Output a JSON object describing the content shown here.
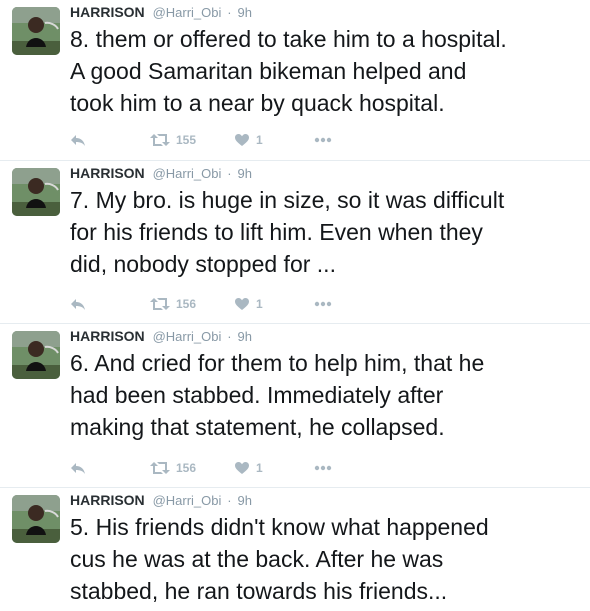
{
  "tweets": [
    {
      "author": "HARRISON",
      "handle": "@Harri_Obi",
      "separator": "·",
      "time": "9h",
      "lines": [
        "8. them or offered to take him to a hospital.",
        "A good Samaritan bikeman helped and",
        "took him to a near by quack hospital."
      ],
      "retweets": "155",
      "likes": "1"
    },
    {
      "author": "HARRISON",
      "handle": "@Harri_Obi",
      "separator": "·",
      "time": "9h",
      "lines": [
        "7. My bro. is huge in size, so it was difficult",
        "for his friends to lift him. Even when they",
        "did, nobody stopped for ..."
      ],
      "retweets": "156",
      "likes": "1"
    },
    {
      "author": "HARRISON",
      "handle": "@Harri_Obi",
      "separator": "·",
      "time": "9h",
      "lines": [
        "6. And cried for them to help him, that he",
        "had been stabbed. Immediately after",
        "making that statement, he collapsed."
      ],
      "retweets": "156",
      "likes": "1"
    },
    {
      "author": "HARRISON",
      "handle": "@Harri_Obi",
      "separator": "·",
      "time": "9h",
      "lines": [
        "5. His friends didn't know what happened",
        "cus he was at the back. After he was",
        "stabbed, he ran towards his friends..."
      ],
      "retweets": "",
      "likes": ""
    }
  ],
  "icons": {
    "reply": "reply-icon",
    "retweet": "retweet-icon",
    "like": "heart-icon",
    "more": "more-dots-icon"
  },
  "colors": {
    "action_gray": "#aab8c2",
    "meta_gray": "#8899a6",
    "divider": "#e6ecf0"
  }
}
